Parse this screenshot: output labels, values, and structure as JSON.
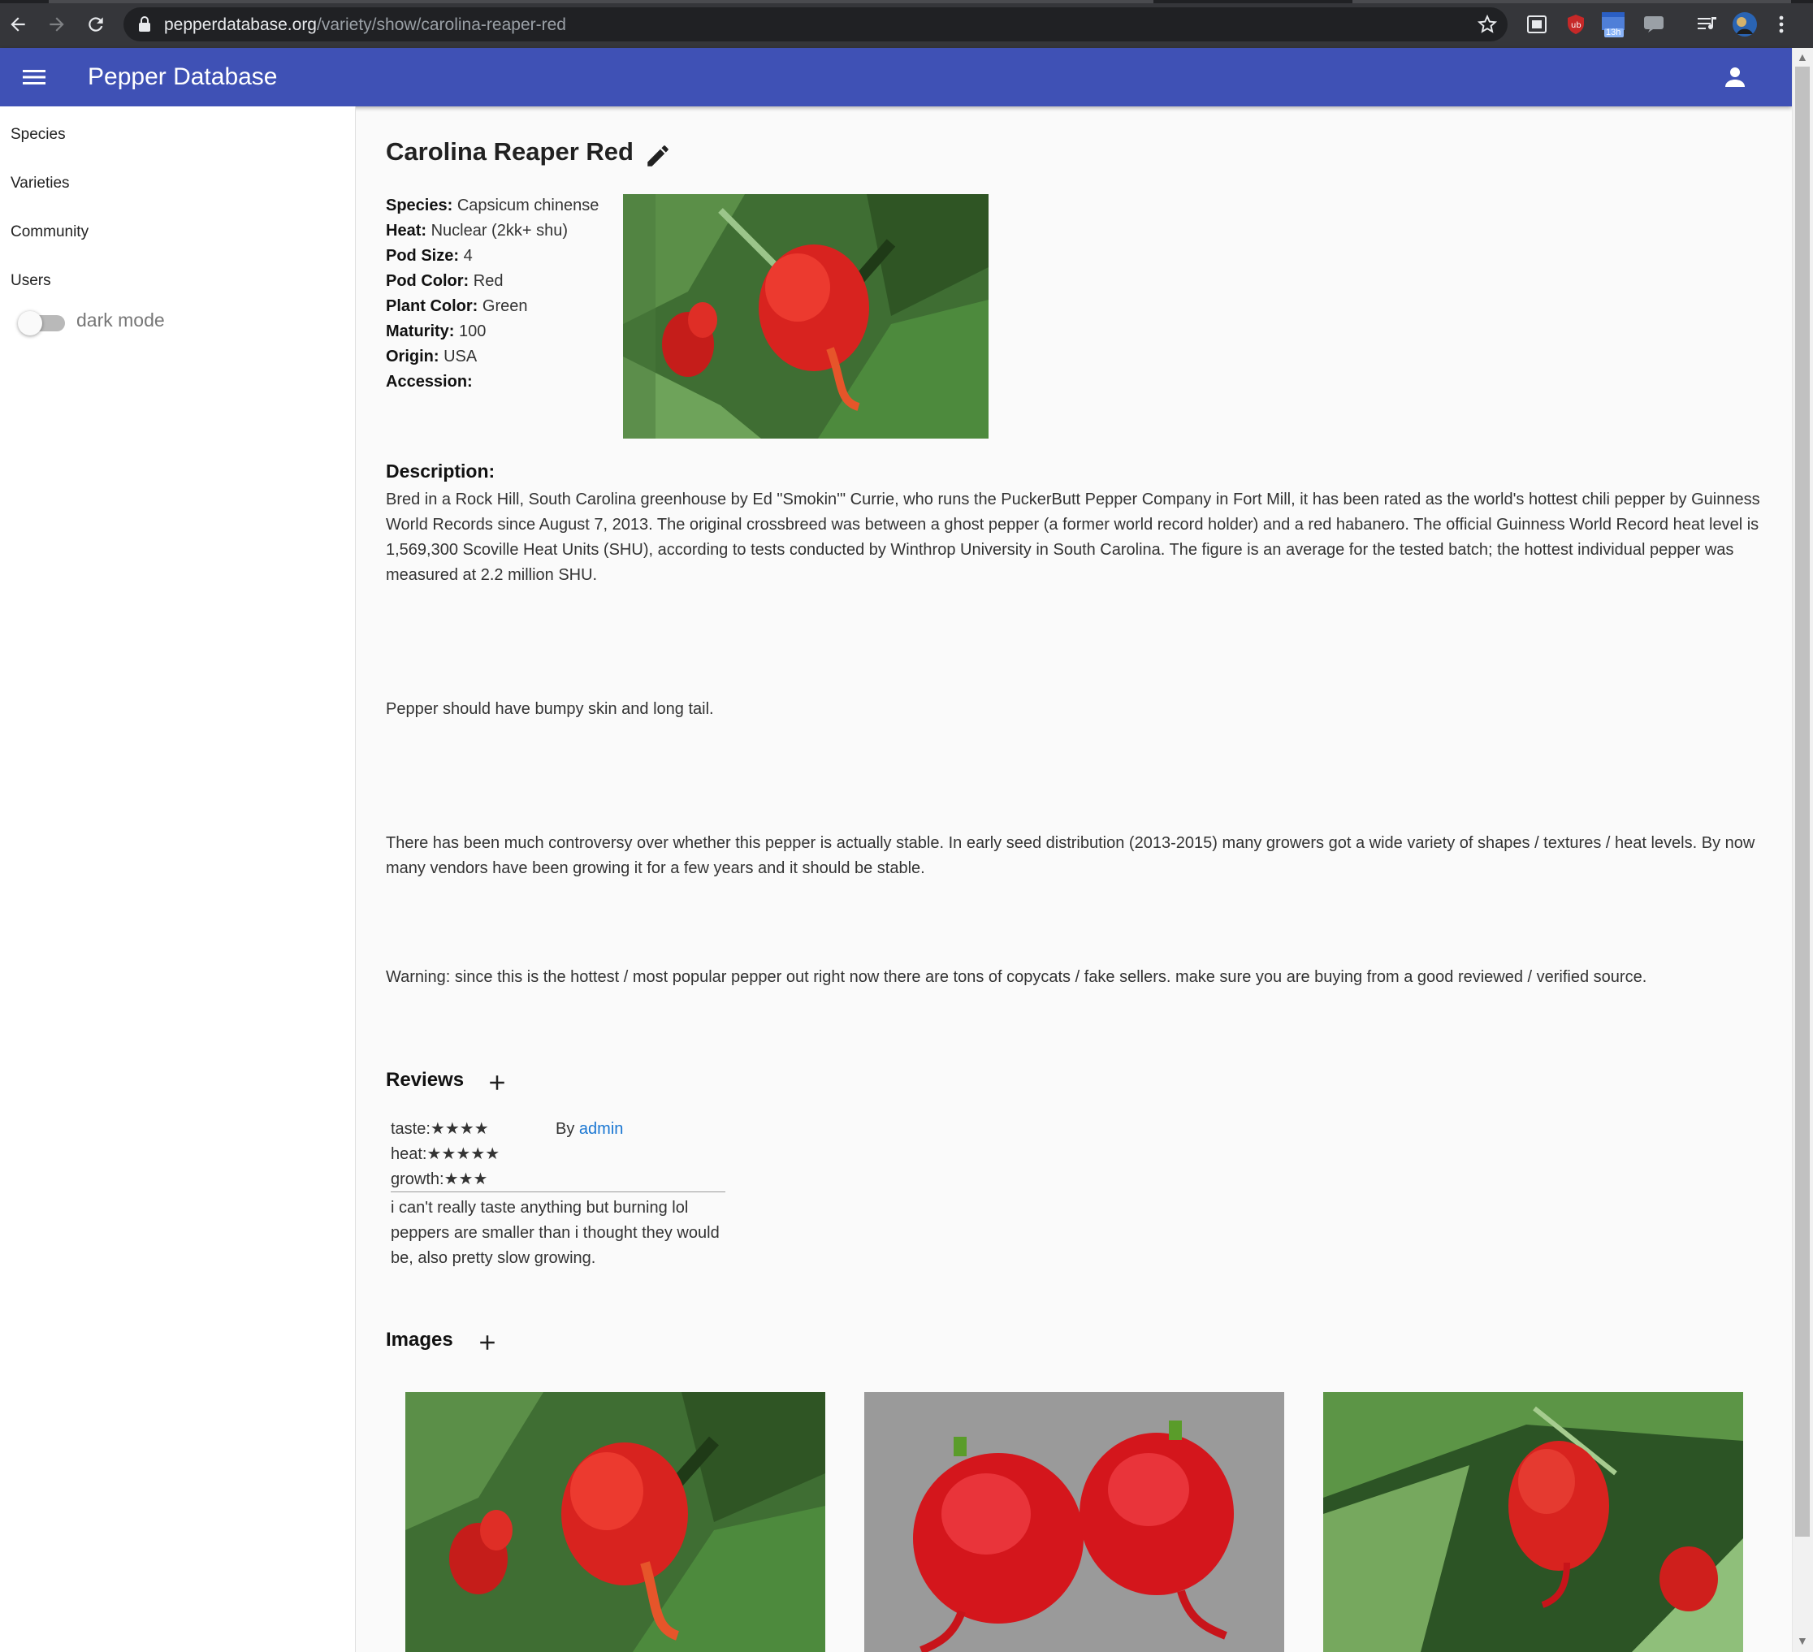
{
  "browser": {
    "url_host": "pepperdatabase.org",
    "url_path": "/variety/show/carolina-reaper-red",
    "badge_count": "13h"
  },
  "appbar": {
    "title": "Pepper Database"
  },
  "sidebar": {
    "items": [
      {
        "label": "Species"
      },
      {
        "label": "Varieties"
      },
      {
        "label": "Community"
      },
      {
        "label": "Users"
      }
    ],
    "dark_mode_label": "dark mode",
    "dark_mode_on": false
  },
  "variety": {
    "name": "Carolina Reaper Red",
    "properties": [
      {
        "label": "Species:",
        "value": "Capsicum chinense"
      },
      {
        "label": "Heat:",
        "value": "Nuclear (2kk+ shu)"
      },
      {
        "label": "Pod Size:",
        "value": "4"
      },
      {
        "label": "Pod Color:",
        "value": "Red"
      },
      {
        "label": "Plant Color:",
        "value": "Green"
      },
      {
        "label": "Maturity:",
        "value": "100"
      },
      {
        "label": "Origin:",
        "value": "USA"
      },
      {
        "label": "Accession:",
        "value": ""
      }
    ],
    "description_label": "Description:",
    "description_paragraphs": [
      "Bred in a Rock Hill, South Carolina greenhouse by Ed \"Smokin'\" Currie, who runs the PuckerButt Pepper Company in Fort Mill, it has been rated as the world's hottest chili pepper by Guinness World Records since August 7, 2013. The original crossbreed was between a ghost pepper (a former world record holder) and a red habanero. The official Guinness World Record heat level is 1,569,300 Scoville Heat Units (SHU), according to tests conducted by Winthrop University in South Carolina. The figure is an average for the tested batch; the hottest individual pepper was measured at 2.2 million SHU.",
      "Pepper should have bumpy skin and long tail.",
      "There has been much controversy over whether this pepper is actually stable. In early seed distribution (2013-2015) many growers got a wide variety of shapes / textures / heat levels. By now many vendors have been growing it for a few years and it should be stable.",
      "Warning: since this is the hottest / most popular pepper out right now there are tons of copycats / fake sellers. make sure you are buying from a good reviewed / verified source."
    ]
  },
  "reviews": {
    "heading": "Reviews",
    "items": [
      {
        "taste_label": "taste:",
        "taste_stars": "★★★★",
        "heat_label": "heat:",
        "heat_stars": "★★★★★",
        "growth_label": "growth:",
        "growth_stars": "★★★",
        "by_label": "By",
        "author": "admin",
        "comment": "i can't really taste anything but burning lol peppers are smaller than i thought they would be, also pretty slow growing."
      }
    ]
  },
  "images": {
    "heading": "Images"
  },
  "colors": {
    "appbar": "#3f51b5",
    "link": "#1976d2",
    "pepper_red": "#e02020",
    "leaf_green": "#2e6b2a"
  }
}
